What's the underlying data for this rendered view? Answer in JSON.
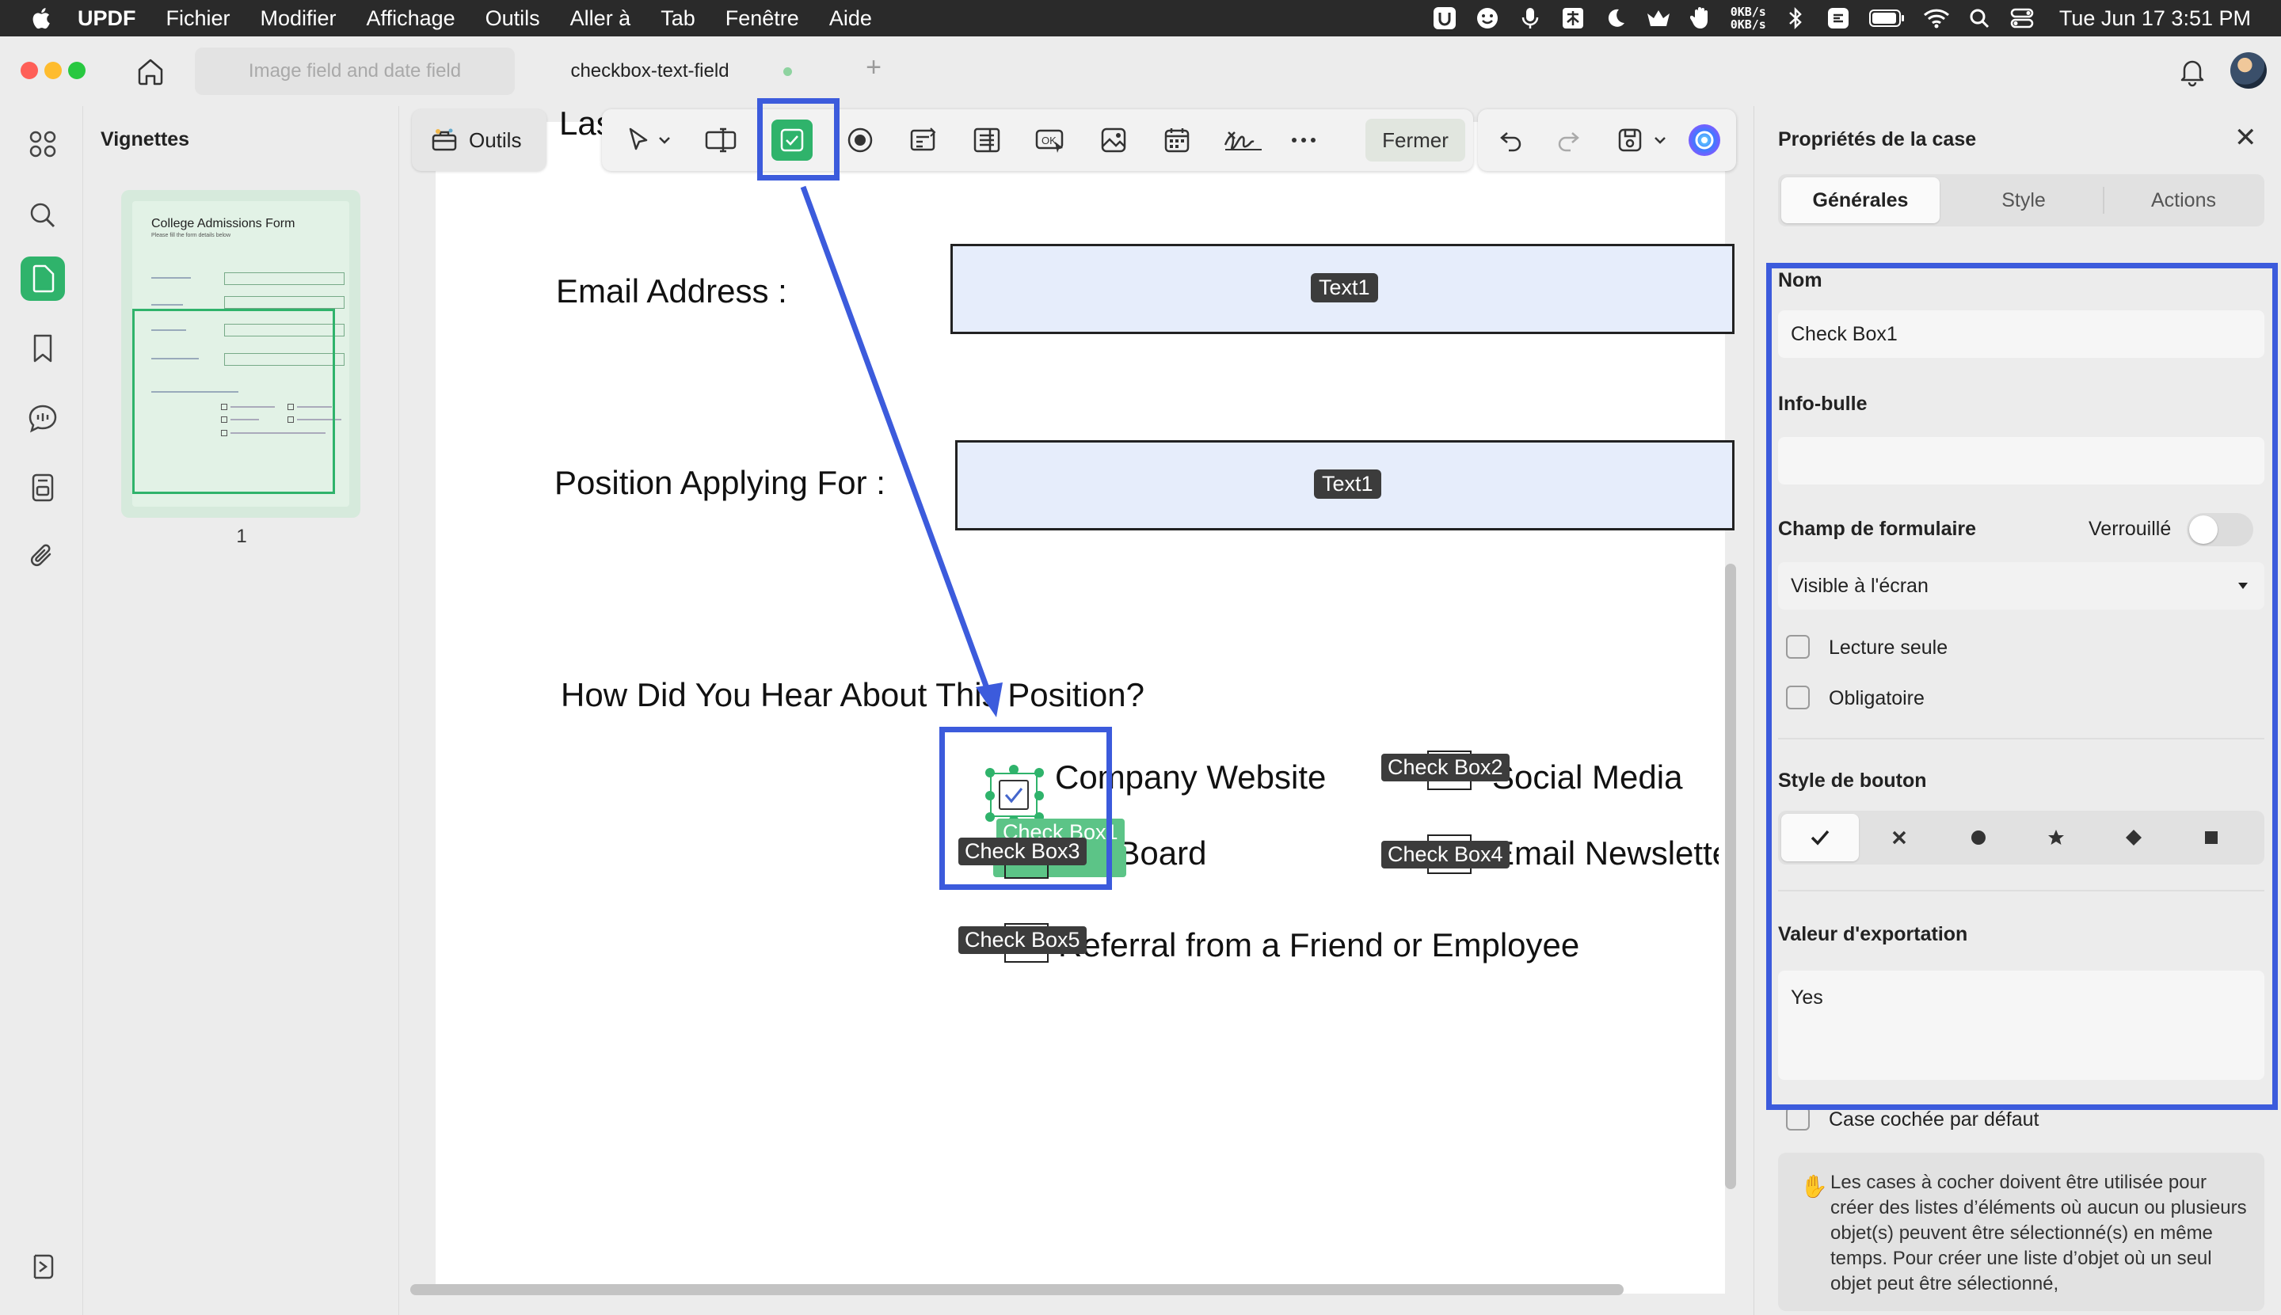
{
  "menubar": {
    "app_name": "UPDF",
    "items": [
      "Fichier",
      "Modifier",
      "Affichage",
      "Outils",
      "Aller à",
      "Tab",
      "Fenêtre",
      "Aide"
    ],
    "net_up": "0KB/s",
    "net_down": "0KB/s",
    "clock": "Tue Jun 17  3:51 PM"
  },
  "tabs": [
    {
      "label": "Image field and date field"
    },
    {
      "label": "checkbox-text-field"
    }
  ],
  "thumbnails": {
    "title": "Vignettes",
    "page_number": "1",
    "mini": {
      "title": "College Admissions Form",
      "subtitle": "Please fill the form details below"
    }
  },
  "toolbar": {
    "outils_label": "Outils",
    "fermer_label": "Fermer"
  },
  "document": {
    "partial_top_label": "Las",
    "email_label": "Email Address :",
    "email_field_tag": "Text1",
    "position_label": "Position Applying For :",
    "position_field_tag": "Text1",
    "question_label": "How Did You Hear About This Position?",
    "options": {
      "company_website": "Company Website",
      "social_media": "Social Media",
      "job_board": "Job Board",
      "email_newsletter": "Email Newsletter",
      "referral": "Referral from a Friend or Employee"
    },
    "checkbox_tags": {
      "cb1": "Check Box1",
      "cb2": "Check Box2",
      "cb3": "Check Box3",
      "cb4": "Check Box4",
      "cb5": "Check Box5"
    }
  },
  "properties": {
    "header": "Propriétés de la case",
    "tabs": {
      "general": "Générales",
      "style": "Style",
      "actions": "Actions"
    },
    "name_label": "Nom",
    "name_value": "Check Box1",
    "tooltip_label": "Info-bulle",
    "tooltip_value": "",
    "form_field_label": "Champ de formulaire",
    "locked_label": "Verrouillé",
    "visibility_value": "Visible à l'écran",
    "readonly_label": "Lecture seule",
    "required_label": "Obligatoire",
    "button_style_label": "Style de bouton",
    "export_label": "Valeur d'exportation",
    "export_value": "Yes",
    "default_checked_label": "Case cochée par défaut",
    "info_text": "Les cases à cocher doivent être utilisée pour créer des listes d’éléments où aucun ou plusieurs objet(s) peuvent être sélectionné(s) en même temps. Pour créer une liste d’objet où un seul objet peut être sélectionné,"
  },
  "colors": {
    "accent_green": "#2fb36b",
    "highlight_blue": "#3c5bdc",
    "field_fill": "#e6edfb"
  }
}
